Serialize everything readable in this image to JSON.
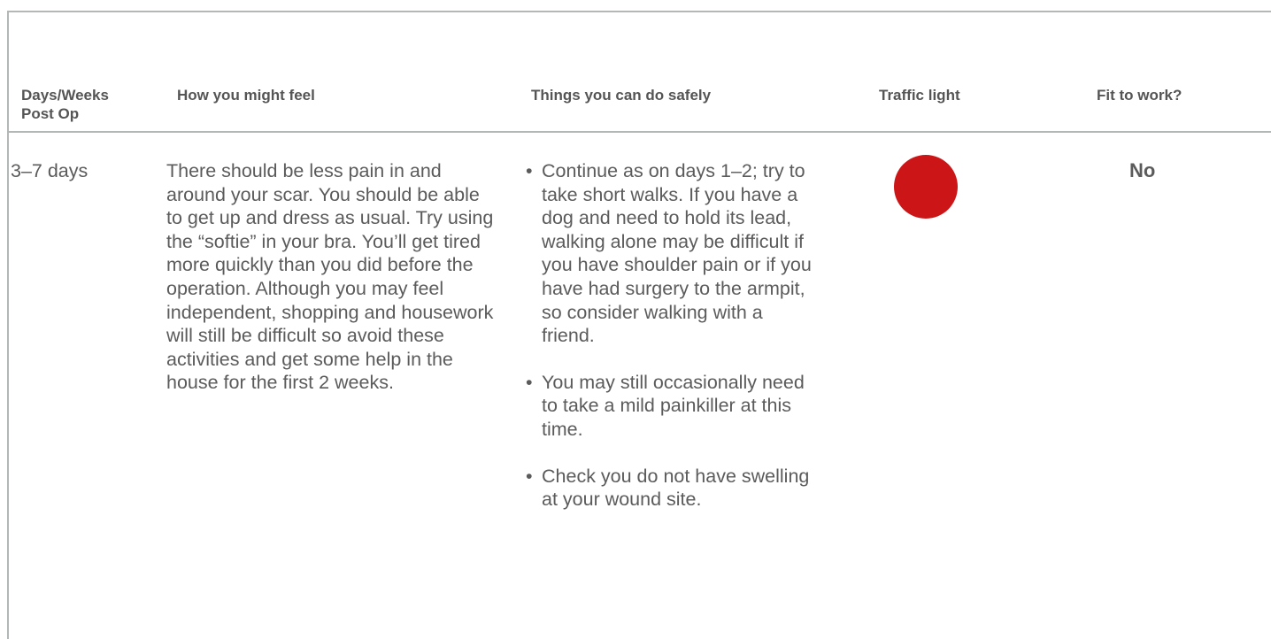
{
  "table": {
    "headers": {
      "days": "Days/Weeks Post Op",
      "feel": "How you might feel",
      "things": "Things you can do safely",
      "traffic": "Traffic light",
      "fit": "Fit to work?"
    },
    "row": {
      "days": "3–7 days",
      "feel": "There should be less pain in and around your scar. You should be able to get up and dress as usual. Try using the “softie” in your bra. You’ll get tired more quickly than you did before the operation. Although you may feel independent, shopping and housework will still be difficult so avoid these activities and get some help in the house for the first 2 weeks.",
      "things": [
        "Continue as on days 1–2; try to take short walks. If you have a dog and need to hold its lead, walking alone may be difficult if you have shoulder pain or if you have had surgery to the armpit, so consider walking with a friend.",
        "You may still occasionally need to take a mild painkiller at this time.",
        "Check you do not have swelling at your wound site."
      ],
      "traffic_light_color": "#cc1517",
      "fit": "No"
    }
  },
  "colors": {
    "border": "#b3b7b6",
    "text": "#5b5b5b"
  }
}
